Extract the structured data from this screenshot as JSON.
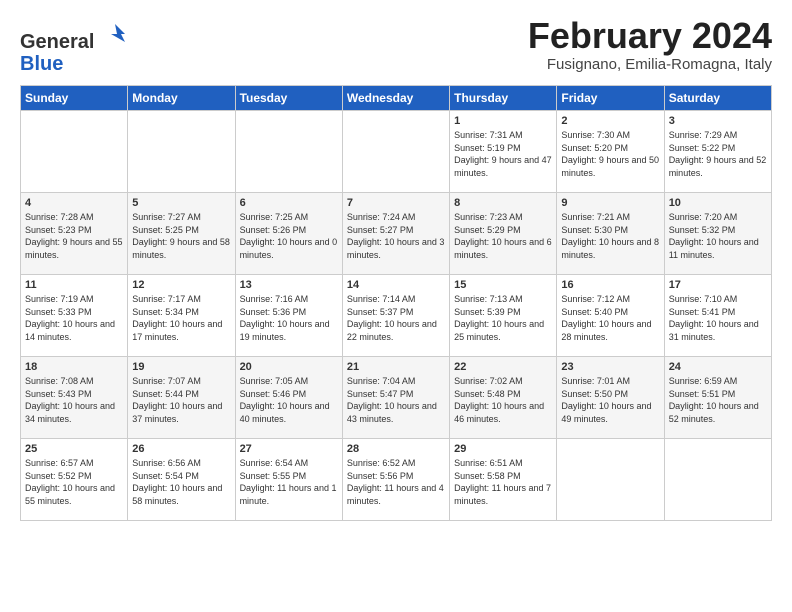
{
  "logo": {
    "general": "General",
    "blue": "Blue"
  },
  "header": {
    "month_year": "February 2024",
    "location": "Fusignano, Emilia-Romagna, Italy"
  },
  "days_of_week": [
    "Sunday",
    "Monday",
    "Tuesday",
    "Wednesday",
    "Thursday",
    "Friday",
    "Saturday"
  ],
  "weeks": [
    [
      {
        "day": "",
        "info": ""
      },
      {
        "day": "",
        "info": ""
      },
      {
        "day": "",
        "info": ""
      },
      {
        "day": "",
        "info": ""
      },
      {
        "day": "1",
        "info": "Sunrise: 7:31 AM\nSunset: 5:19 PM\nDaylight: 9 hours and 47 minutes."
      },
      {
        "day": "2",
        "info": "Sunrise: 7:30 AM\nSunset: 5:20 PM\nDaylight: 9 hours and 50 minutes."
      },
      {
        "day": "3",
        "info": "Sunrise: 7:29 AM\nSunset: 5:22 PM\nDaylight: 9 hours and 52 minutes."
      }
    ],
    [
      {
        "day": "4",
        "info": "Sunrise: 7:28 AM\nSunset: 5:23 PM\nDaylight: 9 hours and 55 minutes."
      },
      {
        "day": "5",
        "info": "Sunrise: 7:27 AM\nSunset: 5:25 PM\nDaylight: 9 hours and 58 minutes."
      },
      {
        "day": "6",
        "info": "Sunrise: 7:25 AM\nSunset: 5:26 PM\nDaylight: 10 hours and 0 minutes."
      },
      {
        "day": "7",
        "info": "Sunrise: 7:24 AM\nSunset: 5:27 PM\nDaylight: 10 hours and 3 minutes."
      },
      {
        "day": "8",
        "info": "Sunrise: 7:23 AM\nSunset: 5:29 PM\nDaylight: 10 hours and 6 minutes."
      },
      {
        "day": "9",
        "info": "Sunrise: 7:21 AM\nSunset: 5:30 PM\nDaylight: 10 hours and 8 minutes."
      },
      {
        "day": "10",
        "info": "Sunrise: 7:20 AM\nSunset: 5:32 PM\nDaylight: 10 hours and 11 minutes."
      }
    ],
    [
      {
        "day": "11",
        "info": "Sunrise: 7:19 AM\nSunset: 5:33 PM\nDaylight: 10 hours and 14 minutes."
      },
      {
        "day": "12",
        "info": "Sunrise: 7:17 AM\nSunset: 5:34 PM\nDaylight: 10 hours and 17 minutes."
      },
      {
        "day": "13",
        "info": "Sunrise: 7:16 AM\nSunset: 5:36 PM\nDaylight: 10 hours and 19 minutes."
      },
      {
        "day": "14",
        "info": "Sunrise: 7:14 AM\nSunset: 5:37 PM\nDaylight: 10 hours and 22 minutes."
      },
      {
        "day": "15",
        "info": "Sunrise: 7:13 AM\nSunset: 5:39 PM\nDaylight: 10 hours and 25 minutes."
      },
      {
        "day": "16",
        "info": "Sunrise: 7:12 AM\nSunset: 5:40 PM\nDaylight: 10 hours and 28 minutes."
      },
      {
        "day": "17",
        "info": "Sunrise: 7:10 AM\nSunset: 5:41 PM\nDaylight: 10 hours and 31 minutes."
      }
    ],
    [
      {
        "day": "18",
        "info": "Sunrise: 7:08 AM\nSunset: 5:43 PM\nDaylight: 10 hours and 34 minutes."
      },
      {
        "day": "19",
        "info": "Sunrise: 7:07 AM\nSunset: 5:44 PM\nDaylight: 10 hours and 37 minutes."
      },
      {
        "day": "20",
        "info": "Sunrise: 7:05 AM\nSunset: 5:46 PM\nDaylight: 10 hours and 40 minutes."
      },
      {
        "day": "21",
        "info": "Sunrise: 7:04 AM\nSunset: 5:47 PM\nDaylight: 10 hours and 43 minutes."
      },
      {
        "day": "22",
        "info": "Sunrise: 7:02 AM\nSunset: 5:48 PM\nDaylight: 10 hours and 46 minutes."
      },
      {
        "day": "23",
        "info": "Sunrise: 7:01 AM\nSunset: 5:50 PM\nDaylight: 10 hours and 49 minutes."
      },
      {
        "day": "24",
        "info": "Sunrise: 6:59 AM\nSunset: 5:51 PM\nDaylight: 10 hours and 52 minutes."
      }
    ],
    [
      {
        "day": "25",
        "info": "Sunrise: 6:57 AM\nSunset: 5:52 PM\nDaylight: 10 hours and 55 minutes."
      },
      {
        "day": "26",
        "info": "Sunrise: 6:56 AM\nSunset: 5:54 PM\nDaylight: 10 hours and 58 minutes."
      },
      {
        "day": "27",
        "info": "Sunrise: 6:54 AM\nSunset: 5:55 PM\nDaylight: 11 hours and 1 minute."
      },
      {
        "day": "28",
        "info": "Sunrise: 6:52 AM\nSunset: 5:56 PM\nDaylight: 11 hours and 4 minutes."
      },
      {
        "day": "29",
        "info": "Sunrise: 6:51 AM\nSunset: 5:58 PM\nDaylight: 11 hours and 7 minutes."
      },
      {
        "day": "",
        "info": ""
      },
      {
        "day": "",
        "info": ""
      }
    ]
  ]
}
